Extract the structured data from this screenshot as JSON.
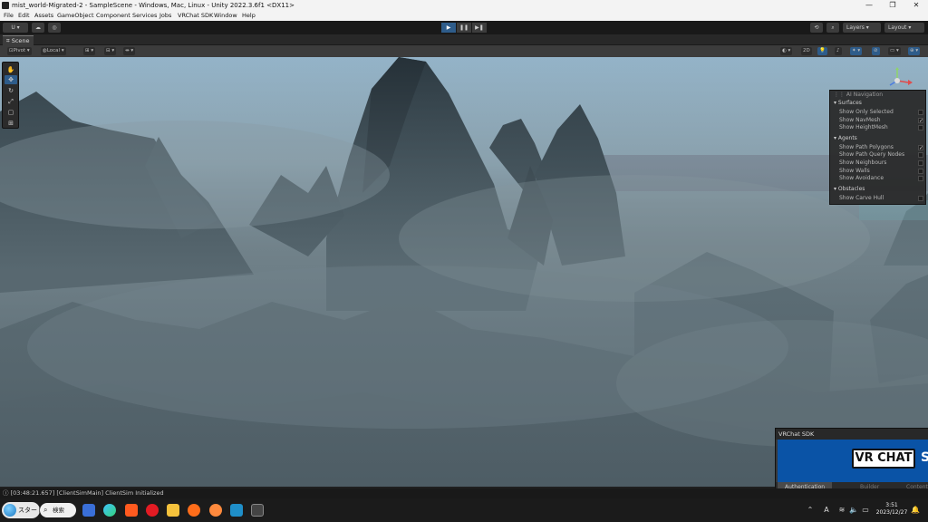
{
  "window": {
    "title": "mist_world-Migrated-2 - SampleScene - Windows, Mac, Linux - Unity 2022.3.6f1 <DX11>",
    "minimize": "—",
    "maximize": "❐",
    "close": "✕"
  },
  "menu": [
    "File",
    "Edit",
    "Assets",
    "GameObject",
    "Component",
    "Services",
    "Jobs",
    "VRChat SDK",
    "Window",
    "Help"
  ],
  "toolbar": {
    "account": "U ▾",
    "play": "▶",
    "pause": "❚❚",
    "step": "▶❚",
    "layers": "Layers",
    "layout": "Layout"
  },
  "scene_tab": {
    "label": "Scene"
  },
  "scene_tools": {
    "pivot": "Pivot",
    "local": "Local",
    "mode_2d": "2D"
  },
  "ai_navigation": {
    "title": "AI Navigation",
    "sections": [
      {
        "name": "Surfaces",
        "items": [
          {
            "label": "Show Only Selected",
            "checked": false
          },
          {
            "label": "Show NavMesh",
            "checked": true
          },
          {
            "label": "Show HeightMesh",
            "checked": false
          }
        ]
      },
      {
        "name": "Agents",
        "items": [
          {
            "label": "Show Path Polygons",
            "checked": true
          },
          {
            "label": "Show Path Query Nodes",
            "checked": false
          },
          {
            "label": "Show Neighbours",
            "checked": false
          },
          {
            "label": "Show Walls",
            "checked": false
          },
          {
            "label": "Show Avoidance",
            "checked": false
          }
        ]
      },
      {
        "name": "Obstacles",
        "items": [
          {
            "label": "Show Carve Hull",
            "checked": false
          }
        ]
      }
    ]
  },
  "vrchat_sdk": {
    "title": "VRChat SDK",
    "logo": "VR CHAT",
    "logo_tail": "S",
    "tabs": [
      "Authentication",
      "Builder",
      "Content"
    ],
    "active_tab": "Authentication"
  },
  "status": {
    "message": "[03:48:21.657] [ClientSimMain] ClientSim Initialized"
  },
  "taskbar": {
    "start": "スタート",
    "search": "検索",
    "clock_time": "3:51",
    "clock_date": "2023/12/27",
    "ime": "A"
  },
  "colors": {
    "accent": "#2e5c8a",
    "vrchat_blue": "#0a53a6",
    "sky_top": "#8fb4cc",
    "fog": "#6b7c84"
  }
}
